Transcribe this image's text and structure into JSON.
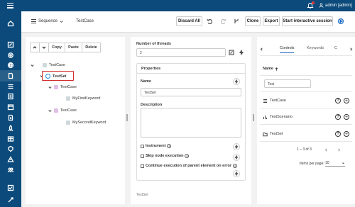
{
  "topbar": {
    "user_label": "admin [admin]"
  },
  "header": {
    "sequence_label": "Sequence",
    "title": "TestCase",
    "discard_all": "Discard All",
    "clone": "Clone",
    "export": "Export",
    "start_session": "Start interactive session"
  },
  "tree": {
    "toolbar": {
      "copy": "Copy",
      "paste": "Paste",
      "delete": "Delete"
    },
    "nodes": [
      {
        "label": "TestCase"
      },
      {
        "label": "TestSet"
      },
      {
        "label": "TestCase"
      },
      {
        "label": "MyFirstKeyword"
      },
      {
        "label": "TestCase"
      },
      {
        "label": "MySecondKeyword"
      }
    ]
  },
  "middle": {
    "threads_label": "Number of threads",
    "threads_value": "2",
    "properties_title": "Properties",
    "name_label": "Name",
    "name_value": "TestSet",
    "description_label": "Description",
    "description_value": "",
    "instrument_label": "Instrument",
    "skip_node_label": "Skip node execution",
    "continue_label": "Continue execution of parent element on error",
    "footer": "TestSet"
  },
  "right": {
    "tabs": [
      "Controls",
      "Keywords",
      "C"
    ],
    "column_header": "Name",
    "search_value": "Test",
    "items": [
      {
        "label": "TestCase",
        "icon": "list-icon"
      },
      {
        "label": "TestScenario",
        "icon": "bar-chart-icon"
      },
      {
        "label": "TestSet",
        "icon": "folder-icon"
      }
    ],
    "pagination": "1 – 3 of 3",
    "items_per_page_label": "Items per page:",
    "items_per_page_value": "10"
  },
  "colors": {
    "brand": "#0b4a7a",
    "selection": "#d32f2f",
    "accent": "#1565c0"
  }
}
